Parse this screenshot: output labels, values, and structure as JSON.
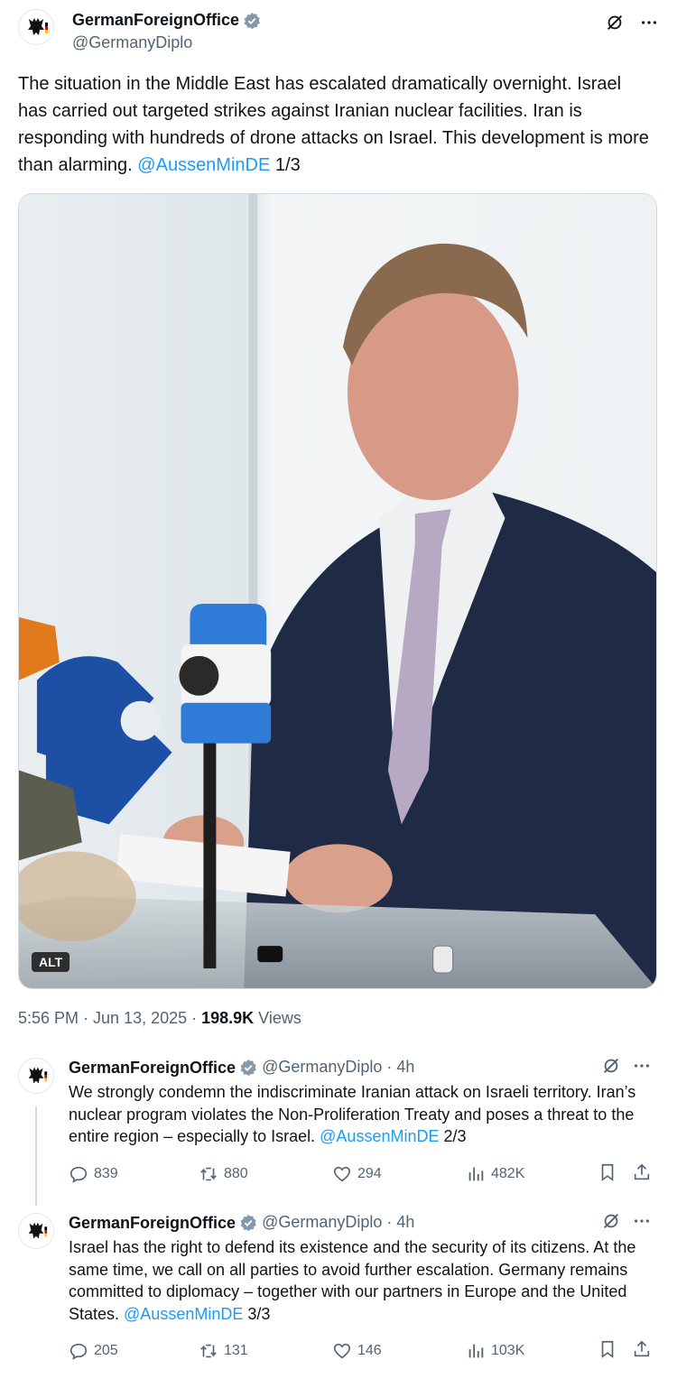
{
  "main": {
    "display_name": "GermanForeignOffice",
    "handle": "@GermanyDiplo",
    "text_1": "The situation in the Middle East has escalated dramatically overnight. Israel has carried out targeted strikes against Iranian nuclear facilities. Iran is responding with hundreds of drone attacks on Israel. This development is more than alarming. ",
    "mention": "@AussenMinDE",
    "text_2": " 1/3",
    "alt_label": "ALT",
    "timestamp": "5:56 PM · Jun 13, 2025 · ",
    "views_count": "198.9K",
    "views_label": " Views"
  },
  "replies": [
    {
      "display_name": "GermanForeignOffice",
      "handle": "@GermanyDiplo",
      "age": "· 4h",
      "text_1": "We strongly condemn the indiscriminate Iranian attack on Israeli territory. Iran’s nuclear program violates the Non-Proliferation Treaty and poses a threat to the entire region – especially to Israel. ",
      "mention": "@AussenMinDE",
      "text_2": " 2/3",
      "replies": "839",
      "reposts": "880",
      "likes": "294",
      "views": "482K"
    },
    {
      "display_name": "GermanForeignOffice",
      "handle": "@GermanyDiplo",
      "age": "· 4h",
      "text_1": "Israel has the right to defend its existence and the security of its citizens. At the same time, we call on all parties to avoid further escalation. Germany remains committed to diplomacy – together with our partners in Europe and the United States. ",
      "mention": "@AussenMinDE",
      "text_2": " 3/3",
      "replies": "205",
      "reposts": "131",
      "likes": "146",
      "views": "103K"
    }
  ],
  "colors": {
    "accent": "#1d9bf0",
    "secondary_text": "#536471",
    "verified": "#829aab"
  }
}
